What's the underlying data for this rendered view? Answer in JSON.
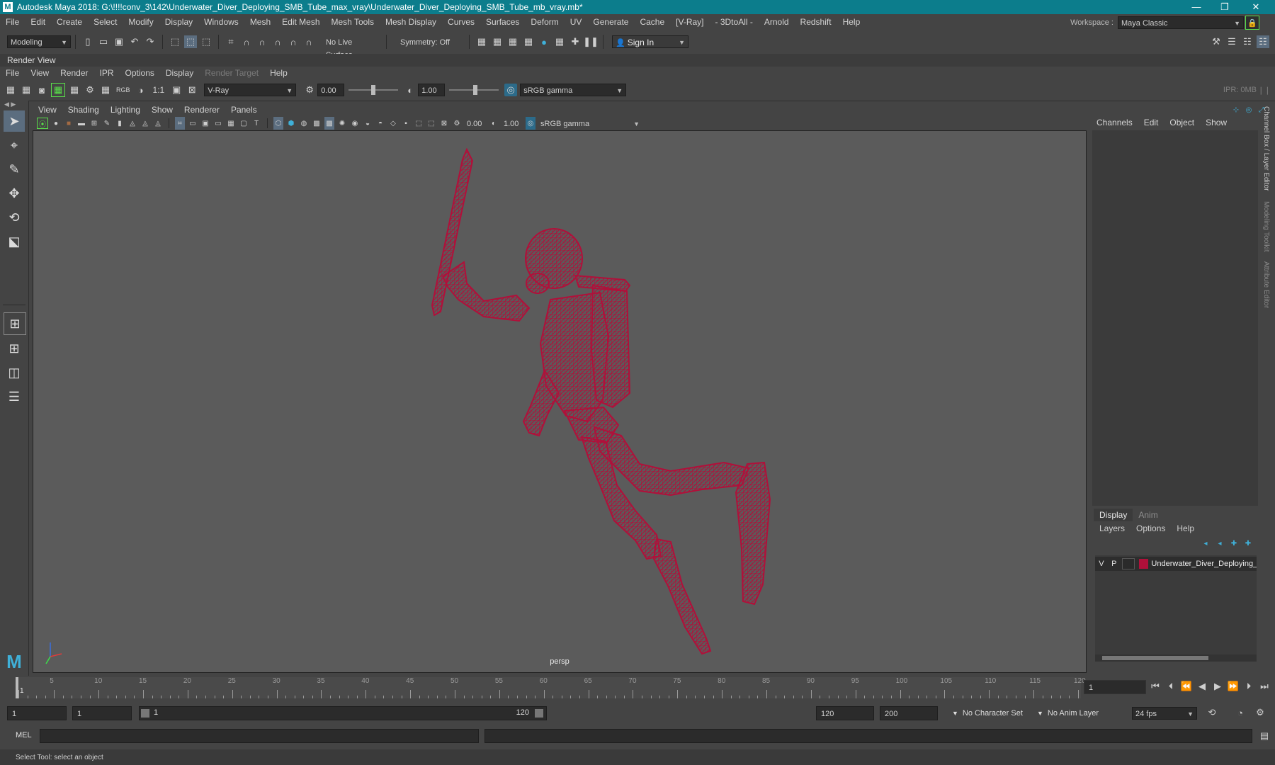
{
  "app": {
    "title": "Autodesk Maya 2018: G:\\!!!!conv_3\\142\\Underwater_Diver_Deploying_SMB_Tube_max_vray\\Underwater_Diver_Deploying_SMB_Tube_mb_vray.mb*",
    "logo": "M"
  },
  "menubar": {
    "items": [
      "File",
      "Edit",
      "Create",
      "Select",
      "Modify",
      "Display",
      "Windows",
      "Mesh",
      "Edit Mesh",
      "Mesh Tools",
      "Mesh Display",
      "Curves",
      "Surfaces",
      "Deform",
      "UV",
      "Generate",
      "Cache"
    ],
    "vray": "[V-Ray]",
    "items2": [
      "- 3DtoAll -",
      "Arnold",
      "Redshift",
      "Help"
    ],
    "workspace_label": "Workspace :",
    "workspace_value": "Maya Classic"
  },
  "statusline": {
    "menuset": "Modeling",
    "live_surface": "No Live Surface",
    "symmetry": "Symmetry: Off",
    "sign_in": "Sign In"
  },
  "render_view": {
    "title": "Render View",
    "menu": [
      "File",
      "View",
      "Render",
      "IPR",
      "Options",
      "Display"
    ],
    "menu_disabled": "Render Target",
    "menu_help": "Help",
    "rgb": "RGB",
    "ratio": "1:1",
    "renderer": "V-Ray",
    "exposure": "0.00",
    "gamma": "1.00",
    "colorspace": "sRGB gamma",
    "ipr": "IPR: 0MB"
  },
  "viewport": {
    "menu": [
      "View",
      "Shading",
      "Lighting",
      "Show",
      "Renderer",
      "Panels"
    ],
    "exposure": "0.00",
    "gamma": "1.00",
    "colorspace": "sRGB gamma",
    "camera": "persp",
    "wire_color": "#b0103a"
  },
  "channelbox": {
    "menu": [
      "Channels",
      "Edit",
      "Object",
      "Show"
    ]
  },
  "layers": {
    "tabs": [
      "Display",
      "Anim"
    ],
    "menu": [
      "Layers",
      "Options",
      "Help"
    ],
    "layer": {
      "v": "V",
      "p": "P",
      "name": "Underwater_Diver_Deploying_",
      "color": "#b0103a"
    }
  },
  "sidetabs": [
    "Channel Box / Layer Editor",
    "Modeling Toolkit",
    "Attribute Editor"
  ],
  "timeline": {
    "ticks": [
      1,
      5,
      10,
      15,
      20,
      25,
      30,
      35,
      40,
      45,
      50,
      55,
      60,
      65,
      70,
      75,
      80,
      85,
      90,
      95,
      100,
      105,
      110,
      115,
      120
    ],
    "current_frame": "1"
  },
  "range": {
    "start": "1",
    "playback_start": "1",
    "slider_start": "1",
    "slider_end": "120",
    "playback_end": "120",
    "end": "200",
    "character_set": "No Character Set",
    "anim_layer": "No Anim Layer",
    "fps": "24 fps"
  },
  "command": {
    "lang": "MEL"
  },
  "help": {
    "text": "Select Tool: select an object"
  }
}
